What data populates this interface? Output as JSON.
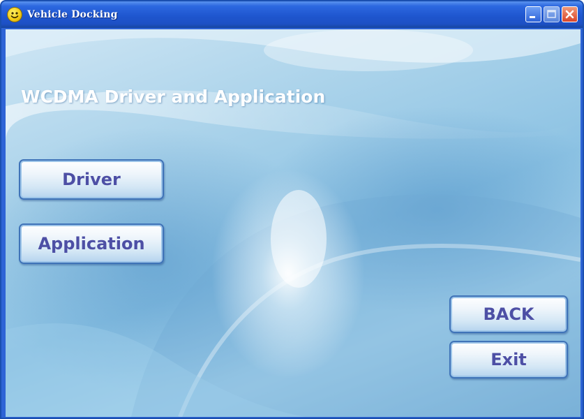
{
  "window": {
    "title": "Vehicle Docking",
    "icon": "smiley-icon",
    "controls": [
      "minimize-icon",
      "maximize-icon",
      "close-icon"
    ]
  },
  "main": {
    "heading": "WCDMA Driver and Application",
    "buttons": {
      "driver": "Driver",
      "application": "Application",
      "back": "BACK",
      "exit": "Exit"
    }
  },
  "colors": {
    "titlebar": "#1f56cf",
    "background": "#8cc2e3",
    "button_text": "#4d4fa5",
    "button_border": "#3f73b8",
    "close_button": "#d9462a"
  }
}
